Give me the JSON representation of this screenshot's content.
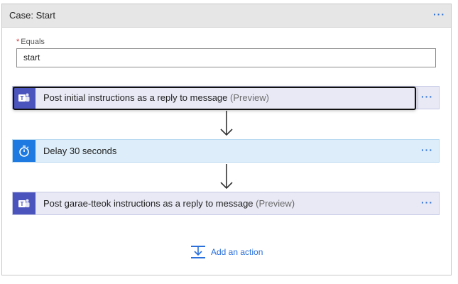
{
  "case": {
    "title": "Case: Start",
    "more_label": "···"
  },
  "equals": {
    "required_mark": "*",
    "label": "Equals",
    "value": "start"
  },
  "actions": [
    {
      "label": "Post initial instructions as a reply to message",
      "suffix": "(Preview)",
      "icon": "teams-icon",
      "more_label": "···"
    },
    {
      "label": "Delay 30 seconds",
      "suffix": "",
      "icon": "timer-icon",
      "more_label": "···"
    },
    {
      "label": "Post garae-tteok instructions as a reply to message",
      "suffix": "(Preview)",
      "icon": "teams-icon",
      "more_label": "···"
    }
  ],
  "add_action": {
    "label": "Add an action",
    "icon": "add-action-icon"
  },
  "colors": {
    "teams_brand": "#4b53bc",
    "delay_brand": "#1e7ae0",
    "link": "#2a6fdb",
    "required": "#d13438"
  }
}
